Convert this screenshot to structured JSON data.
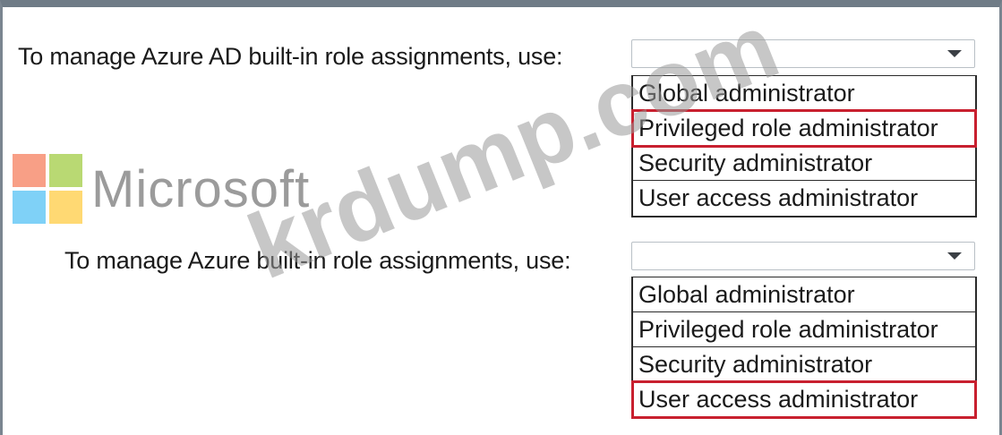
{
  "questions": [
    {
      "prompt": "To manage Azure AD built-in role assignments, use:",
      "selected_value": "",
      "options": [
        "Global administrator",
        "Privileged role administrator",
        "Security administrator",
        "User access administrator"
      ],
      "highlighted_option": "Privileged role administrator"
    },
    {
      "prompt": "To manage Azure built-in role assignments, use:",
      "selected_value": "",
      "options": [
        "Global administrator",
        "Privileged role administrator",
        "Security administrator",
        "User access administrator"
      ],
      "highlighted_option": "User access administrator"
    }
  ],
  "logo": {
    "wordmark": "Microsoft",
    "square_colors": [
      "#f25022",
      "#7fba00",
      "#00a4ef",
      "#ffb900"
    ]
  },
  "watermark": "krdump.com",
  "colors": {
    "highlight": "#c8202f",
    "frame": "#6f7b86"
  },
  "icons": {
    "dropdown": "chevron-down-icon"
  }
}
